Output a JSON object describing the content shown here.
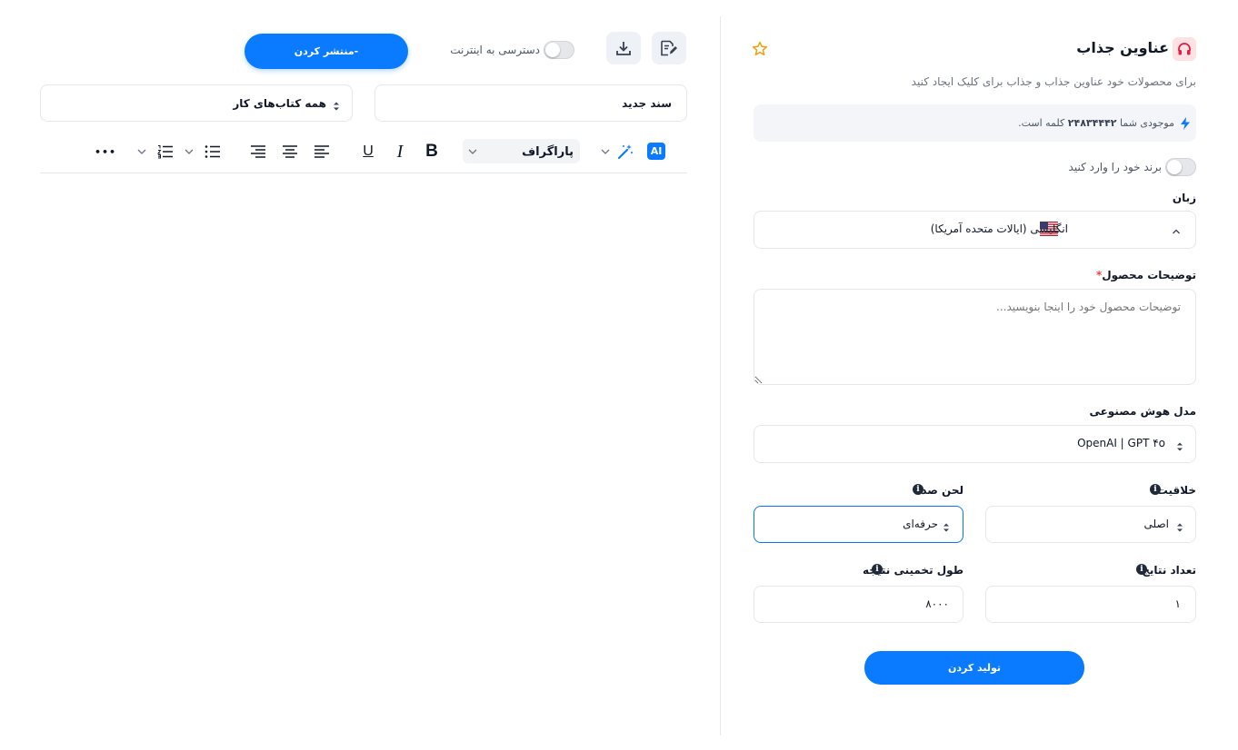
{
  "header": {
    "title": "عناوین جذاب",
    "subtitle": "برای محصولات خود عناوین جذاب و جذاب برای کلیک ایجاد کنید",
    "app_icon": "headphones-icon",
    "favorite_icon": "star-icon"
  },
  "balance": {
    "prefix": "موجودی شما",
    "amount": "۲۴۸۳۴۴۴۲",
    "suffix": "کلمه است.",
    "icon": "bolt-icon"
  },
  "brand": {
    "label": "برند خود را وارد کنید",
    "enabled": false
  },
  "language": {
    "label": "زبان",
    "selected": "انگلیسی (ایالات متحده آمریکا)",
    "flag_icon": "us-flag-icon"
  },
  "product_description": {
    "label": "توضیحات محصول",
    "required_mark": "*",
    "value": "",
    "placeholder": "توضیحات محصول خود را اینجا بنویسید..."
  },
  "ai_model": {
    "label": "مدل هوش مصنوعی",
    "selected": "OpenAI | GPT ۴o"
  },
  "creativity": {
    "label": "خلاقیت",
    "selected": "اصلی"
  },
  "tone": {
    "label": "لحن صدا",
    "selected": "حرفه‌ای"
  },
  "results_count": {
    "label": "تعداد نتایج",
    "value": "۱"
  },
  "estimated_length": {
    "label": "طول تخمینی نتیجه",
    "value": "۸۰۰۰"
  },
  "generate_button": {
    "label": "تولید کردن"
  },
  "editor": {
    "internet_access_label": "دسترسی به اینترنت",
    "internet_access_enabled": false,
    "publish_label": "منتشر کردن-",
    "document_name": "سند جدید",
    "workbook_selected": "همه کتاب‌های کار",
    "toolbar": {
      "ai_label": "AI",
      "paragraph_style": "پاراگراف",
      "bold": "B",
      "italic": "I",
      "underline": "U",
      "more": "•••"
    }
  },
  "colors": {
    "accent": "#0a7bff",
    "required": "#ef4444",
    "star": "#f59e0b",
    "app_icon_bg": "#fde2e4",
    "app_icon": "#e11d48"
  }
}
